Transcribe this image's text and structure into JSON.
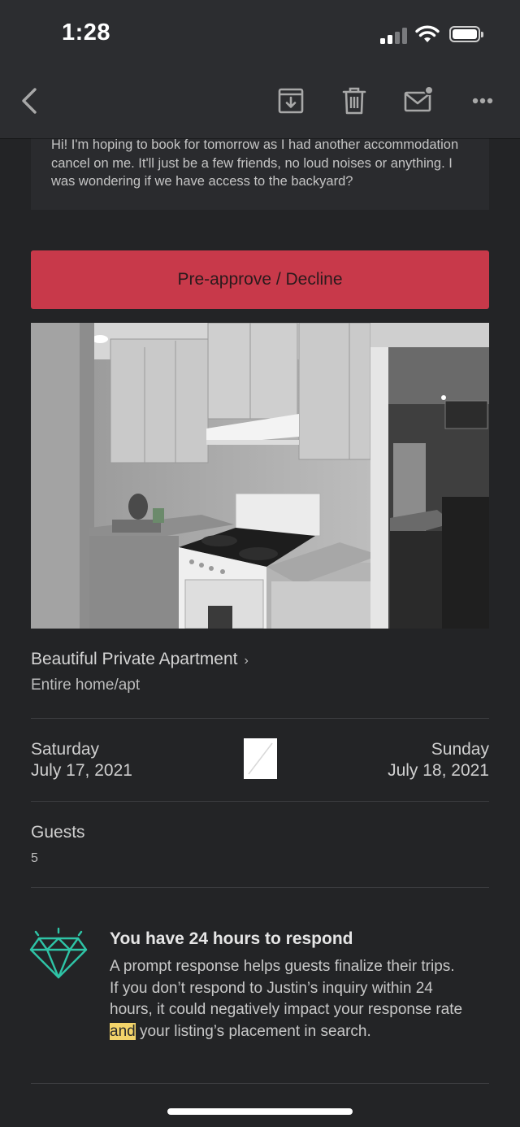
{
  "status_bar": {
    "time": "1:28"
  },
  "toolbar": {
    "back_icon": "chevron-left-icon",
    "archive_icon": "archive-download-icon",
    "trash_icon": "trash-icon",
    "mail_icon": "mail-unread-icon",
    "more_icon": "more-horizontal-icon"
  },
  "message": {
    "line1": "Hi! I'm hoping to book for tomorrow as I had another accommodation",
    "line2": "cancel on me. It'll just be a few friends, no loud noises or anything. I",
    "line3": "was wondering if we have access to the backyard?"
  },
  "action_button": {
    "label": "Pre-approve / Decline",
    "color": "#c8394a"
  },
  "listing": {
    "title": "Beautiful Private Apartment",
    "chevron": "›",
    "type": "Entire home/apt"
  },
  "dates": {
    "checkin_day": "Saturday",
    "checkin_date": "July 17, 2021",
    "checkout_day": "Sunday",
    "checkout_date": "July 18, 2021"
  },
  "guests": {
    "label": "Guests",
    "count": "5"
  },
  "respond": {
    "icon": "diamond-icon",
    "accent": "#2ec4a6",
    "title": "You have 24 hours to respond",
    "line1": "A prompt response helps guests finalize their trips.",
    "line2": "If you don’t respond to Justin’s inquiry within 24",
    "line3": "hours, it could negatively impact your response rate",
    "line4_highlight": "and",
    "line4_rest": " your listing’s placement in search."
  }
}
